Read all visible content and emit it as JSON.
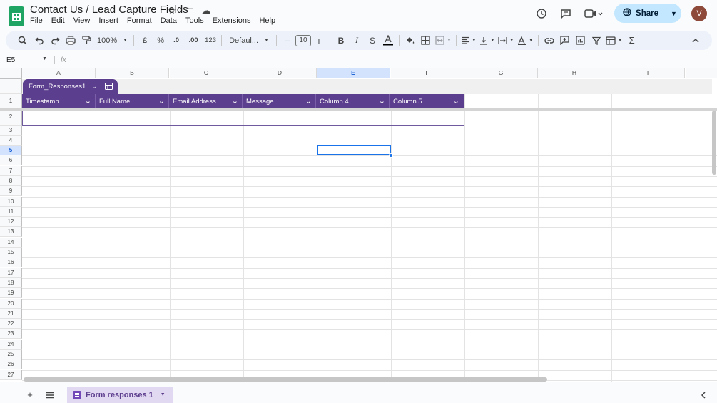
{
  "app": {
    "doc_title": "Contact Us / Lead Capture Fields",
    "menus": [
      "File",
      "Edit",
      "View",
      "Insert",
      "Format",
      "Data",
      "Tools",
      "Extensions",
      "Help"
    ],
    "share_label": "Share",
    "avatar_letter": "V"
  },
  "toolbar": {
    "zoom": "100%",
    "currency": "£",
    "percent": "%",
    "dec_decrease": ".0",
    "dec_increase": ".00",
    "number_format": "123",
    "font": "Defaul...",
    "font_size": "10"
  },
  "formula_bar": {
    "cell_ref": "E5",
    "fx": "fx"
  },
  "grid": {
    "columns": [
      "A",
      "B",
      "C",
      "D",
      "E",
      "F",
      "G",
      "H",
      "I"
    ],
    "selected_column": "E",
    "rows": [
      "1",
      "2",
      "3",
      "4",
      "5",
      "6",
      "7",
      "8",
      "9",
      "10",
      "11",
      "12",
      "13",
      "14",
      "15",
      "16",
      "17",
      "18",
      "19",
      "20",
      "21",
      "22",
      "23",
      "24",
      "25",
      "26",
      "27"
    ],
    "selected_row": "5"
  },
  "table": {
    "name": "Form_Responses1",
    "headers": [
      "Timestamp",
      "Full Name",
      "Email Address",
      "Message",
      "Column 4",
      "Column 5"
    ]
  },
  "sheets": {
    "active_tab": "Form responses 1"
  },
  "colors": {
    "table_header": "#5c3e8e",
    "selection": "#1a73e8",
    "sheets_green": "#1fa463"
  }
}
